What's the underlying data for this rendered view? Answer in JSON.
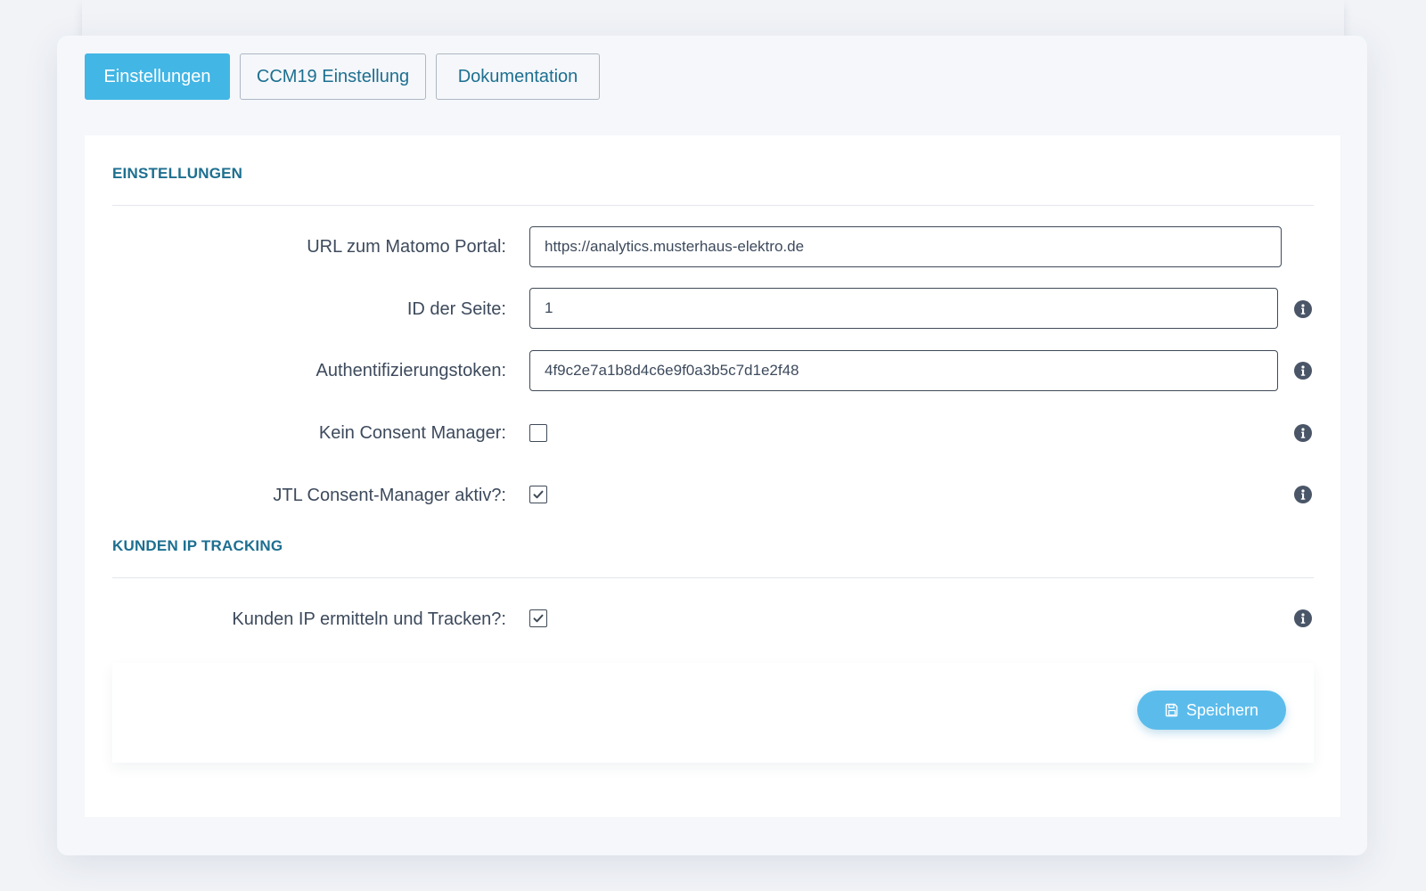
{
  "tabs": [
    {
      "label": "Einstellungen",
      "active": true
    },
    {
      "label": "CCM19 Einstellung",
      "active": false
    },
    {
      "label": "Dokumentation",
      "active": false
    }
  ],
  "sections": {
    "settings": {
      "title": "EINSTELLUNGEN",
      "fields": {
        "matomo_url": {
          "label": "URL zum Matomo Portal:",
          "value": "https://analytics.musterhaus-elektro.de"
        },
        "site_id": {
          "label": "ID der Seite:",
          "value": "1"
        },
        "auth_token": {
          "label": "Authentifizierungstoken:",
          "value": "4f9c2e7a1b8d4c6e9f0a3b5c7d1e2f48"
        },
        "no_consent_manager": {
          "label": "Kein Consent Manager:",
          "checked": false
        },
        "jtl_consent_manager": {
          "label": "JTL Consent-Manager aktiv?:",
          "checked": true
        }
      }
    },
    "ip_tracking": {
      "title": "KUNDEN IP TRACKING",
      "fields": {
        "track_customer_ip": {
          "label": "Kunden IP ermitteln und Tracken?:",
          "checked": true
        }
      }
    }
  },
  "save_button": {
    "label": "Speichern",
    "icon": "floppy-disk-icon"
  },
  "colors": {
    "accent": "#42b6e5",
    "heading": "#1d6f90",
    "text": "#3d4a5c",
    "button": "#5bbcec"
  }
}
